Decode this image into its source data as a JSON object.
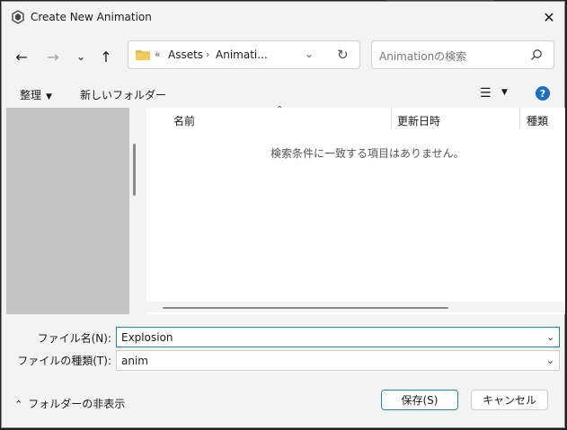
{
  "window": {
    "title": "Create New Animation"
  },
  "address": {
    "overflow": "«",
    "crumbs": [
      "Assets",
      "Animati..."
    ]
  },
  "search": {
    "placeholder": "Animationの検索"
  },
  "toolbar": {
    "organize": "整理",
    "new_folder": "新しいフォルダー"
  },
  "columns": {
    "name": "名前",
    "date_modified": "更新日時",
    "type": "種類"
  },
  "file_list": {
    "empty_message": "検索条件に一致する項目はありません。"
  },
  "form": {
    "filename_label": "ファイル名(N):",
    "filename_value": "Explosion",
    "filetype_label": "ファイルの種類(T):",
    "filetype_value": "anim"
  },
  "footer": {
    "hide_folders": "フォルダーの非表示",
    "save": "保存(S)",
    "cancel": "キャンセル"
  },
  "colors": {
    "accent": "#2a82b0",
    "help": "#1b6ec2",
    "nav_pane": "#c4c4c4"
  }
}
